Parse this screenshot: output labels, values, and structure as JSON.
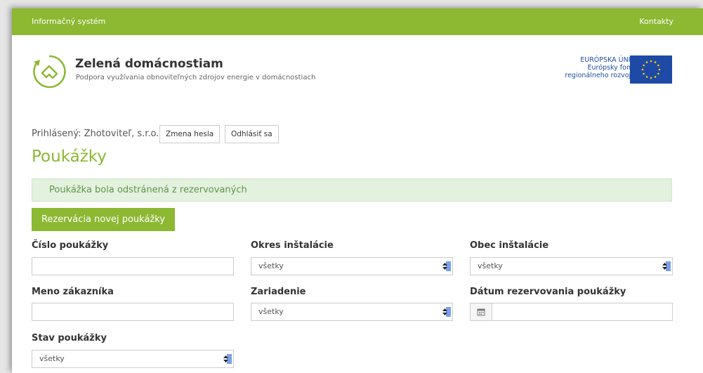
{
  "topbar": {
    "left": "Informačný systém",
    "right": "Kontakty"
  },
  "header": {
    "title": "Zelená domácnostiam",
    "subtitle": "Podpora využívania obnoviteľných zdrojov energie v domácnostiach",
    "eu_line1": "EURÓPSKA ÚNIA",
    "eu_line2": "Európsky fond",
    "eu_line3": "regionálneho rozvoja"
  },
  "user": {
    "logged_text": "Prihlásený: Zhotoviteľ, s.r.o.",
    "change_password": "Zmena hesla",
    "logout": "Odhlásiť sa"
  },
  "page_title": "Poukážky",
  "alert": "Poukážka bola odstránená z rezervovaných",
  "primary_button": "Rezervácia novej poukážky",
  "filters": {
    "voucher_number": {
      "label": "Číslo poukážky",
      "value": ""
    },
    "district": {
      "label": "Okres inštalácie",
      "value": "všetky"
    },
    "municipality": {
      "label": "Obec inštalácie",
      "value": "všetky"
    },
    "customer_name": {
      "label": "Meno zákazníka",
      "value": ""
    },
    "device": {
      "label": "Zariadenie",
      "value": "všetky"
    },
    "reservation_date": {
      "label": "Dátum rezervovania poukážky",
      "value": ""
    },
    "status": {
      "label": "Stav poukážky",
      "value": "všetky"
    }
  },
  "colors": {
    "brand_green": "#8cb832",
    "eu_blue": "#1e4aa6",
    "alert_bg": "#e3f1df"
  }
}
